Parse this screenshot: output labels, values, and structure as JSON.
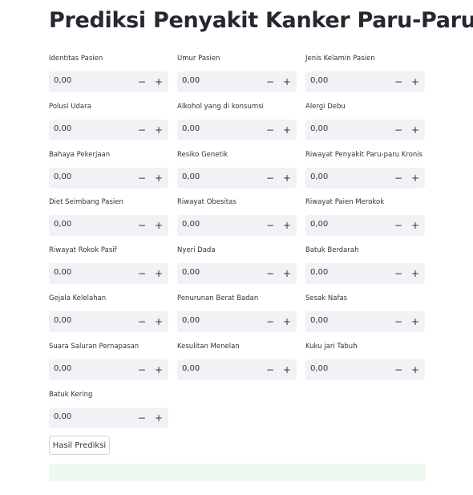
{
  "page": {
    "title": "Prediksi Penyakit Kanker Paru-Paru"
  },
  "stepper": {
    "minus": "−",
    "plus": "+"
  },
  "fields": [
    {
      "name": "identitas-pasien",
      "label": "Identitas Pasien",
      "value": "0,00"
    },
    {
      "name": "umur-pasien",
      "label": "Umur Pasien",
      "value": "0,00"
    },
    {
      "name": "jenis-kelamin-pasien",
      "label": "Jenis Kelamin Pasien",
      "value": "0,00"
    },
    {
      "name": "polusi-udara",
      "label": "Polusi Udara",
      "value": "0,00"
    },
    {
      "name": "alkohol",
      "label": "Alkohol yang di konsumsi",
      "value": "0,00"
    },
    {
      "name": "alergi-debu",
      "label": "Alergi Debu",
      "value": "0,00"
    },
    {
      "name": "bahaya-pekerjaan",
      "label": "Bahaya Pekerjaan",
      "value": "0,00"
    },
    {
      "name": "resiko-genetik",
      "label": "Resiko Genetik",
      "value": "0,00"
    },
    {
      "name": "riwayat-paru-kronis",
      "label": "Riwayat Penyakit Paru-paru Kronis",
      "value": "0,00"
    },
    {
      "name": "diet-seimbang",
      "label": "Diet Seimbang Pasien",
      "value": "0,00"
    },
    {
      "name": "riwayat-obesitas",
      "label": "Riwayat Obesitas",
      "value": "0,00"
    },
    {
      "name": "riwayat-merokok",
      "label": "Riwayat Paien Merokok",
      "value": "0,00"
    },
    {
      "name": "rokok-pasif",
      "label": "Riwayat Rokok Pasif",
      "value": "0,00"
    },
    {
      "name": "nyeri-dada",
      "label": "Nyeri Dada",
      "value": "0,00"
    },
    {
      "name": "batuk-berdarah",
      "label": "Batuk Berdarah",
      "value": "0,00"
    },
    {
      "name": "gejala-kelelahan",
      "label": "Gejala Kelelahan",
      "value": "0,00"
    },
    {
      "name": "penurunan-berat-badan",
      "label": "Penurunan Berat Badan",
      "value": "0,00"
    },
    {
      "name": "sesak-nafas",
      "label": "Sesak Nafas",
      "value": "0,00"
    },
    {
      "name": "suara-saluran-pernapasan",
      "label": "Suara Saluran Pernapasan",
      "value": "0,00"
    },
    {
      "name": "kesulitan-menelan",
      "label": "Kesulitan Menelan",
      "value": "0,00"
    },
    {
      "name": "kuku-jari-tabuh",
      "label": "Kuku jari Tabuh",
      "value": "0,00"
    },
    {
      "name": "batuk-kering",
      "label": "Batuk Kering",
      "value": "0,00"
    }
  ],
  "actions": {
    "predict_label": "Hasil Prediksi"
  },
  "colors": {
    "input_bg": "#f0f2f6",
    "result_bg": "#ecf9ef",
    "title": "#262730"
  }
}
